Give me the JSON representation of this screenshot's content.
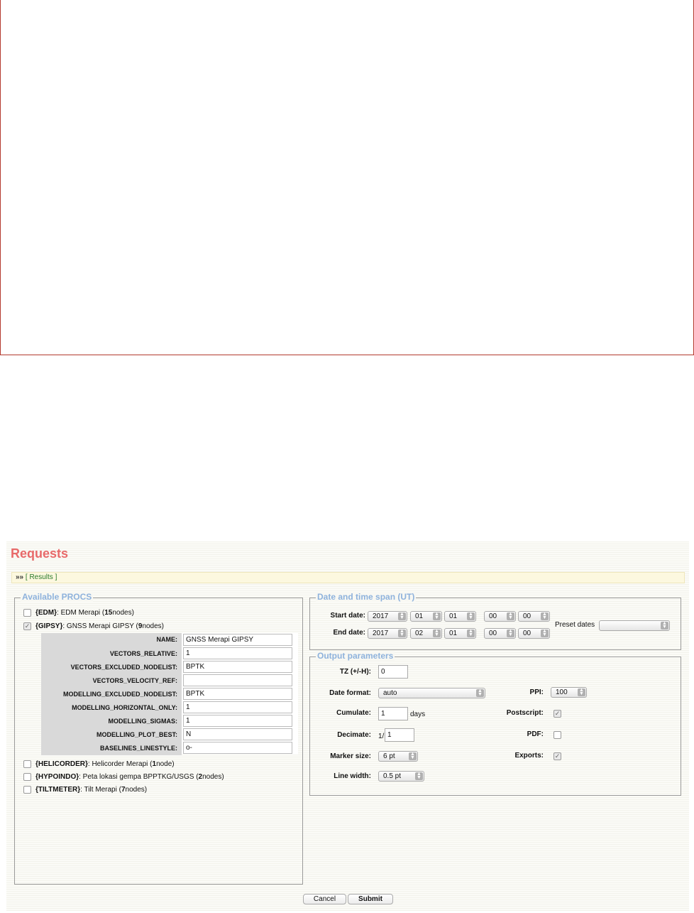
{
  "title": "Requests",
  "results_bar": {
    "raquo": "»»",
    "link": "[ Results ]"
  },
  "procs": {
    "legend": "Available PROCS",
    "items": [
      {
        "code": "{EDM}",
        "desc": ": EDM Merapi (",
        "count": "15",
        "suffix": " nodes)",
        "checked": false
      },
      {
        "code": "{GIPSY}",
        "desc": ": GNSS Merapi GIPSY (",
        "count": "9",
        "suffix": " nodes)",
        "checked": true
      },
      {
        "code": "{HELICORDER}",
        "desc": ": Helicorder Merapi (",
        "count": "1",
        "suffix": " node)",
        "checked": false
      },
      {
        "code": "{HYPOINDO}",
        "desc": ": Peta lokasi gempa BPPTKG/USGS (",
        "count": "2",
        "suffix": " nodes)",
        "checked": false
      },
      {
        "code": "{TILTMETER}",
        "desc": ": Tilt Merapi (",
        "count": "7",
        "suffix": " nodes)",
        "checked": false
      }
    ],
    "params": [
      {
        "label": "NAME:",
        "value": "GNSS Merapi GIPSY"
      },
      {
        "label": "VECTORS_RELATIVE:",
        "value": "1"
      },
      {
        "label": "VECTORS_EXCLUDED_NODELIST:",
        "value": "BPTK"
      },
      {
        "label": "VECTORS_VELOCITY_REF:",
        "value": ""
      },
      {
        "label": "MODELLING_EXCLUDED_NODELIST:",
        "value": "BPTK"
      },
      {
        "label": "MODELLING_HORIZONTAL_ONLY:",
        "value": "1"
      },
      {
        "label": "MODELLING_SIGMAS:",
        "value": "1"
      },
      {
        "label": "MODELLING_PLOT_BEST:",
        "value": "N"
      },
      {
        "label": "BASELINES_LINESTYLE:",
        "value": "o-"
      }
    ]
  },
  "date": {
    "legend": "Date and time span (UT)",
    "start_label": "Start date:",
    "end_label": "End date:",
    "start": {
      "year": "2017",
      "month": "01",
      "day": "01",
      "hour": "00",
      "minute": "00"
    },
    "end": {
      "year": "2017",
      "month": "02",
      "day": "01",
      "hour": "00",
      "minute": "00"
    },
    "preset_label": "Preset dates",
    "preset_value": ""
  },
  "output": {
    "legend": "Output parameters",
    "tz_label": "TZ (+/-H):",
    "tz_value": "0",
    "date_format_label": "Date format:",
    "date_format_value": "auto",
    "cumulate_label": "Cumulate:",
    "cumulate_value": "1",
    "cumulate_unit": "days",
    "decimate_label": "Decimate:",
    "decimate_prefix": "1/",
    "decimate_value": "1",
    "marker_label": "Marker size:",
    "marker_value": "6 pt",
    "linewidth_label": "Line width:",
    "linewidth_value": "0.5 pt",
    "ppi_label": "PPI:",
    "ppi_value": "100",
    "postscript_label": "Postscript:",
    "postscript_checked": true,
    "pdf_label": "PDF:",
    "pdf_checked": false,
    "exports_label": "Exports:",
    "exports_checked": true
  },
  "buttons": {
    "cancel": "Cancel",
    "submit": "Submit"
  },
  "icons": {
    "check": "✓",
    "select_arrows": "⌃⌄"
  }
}
